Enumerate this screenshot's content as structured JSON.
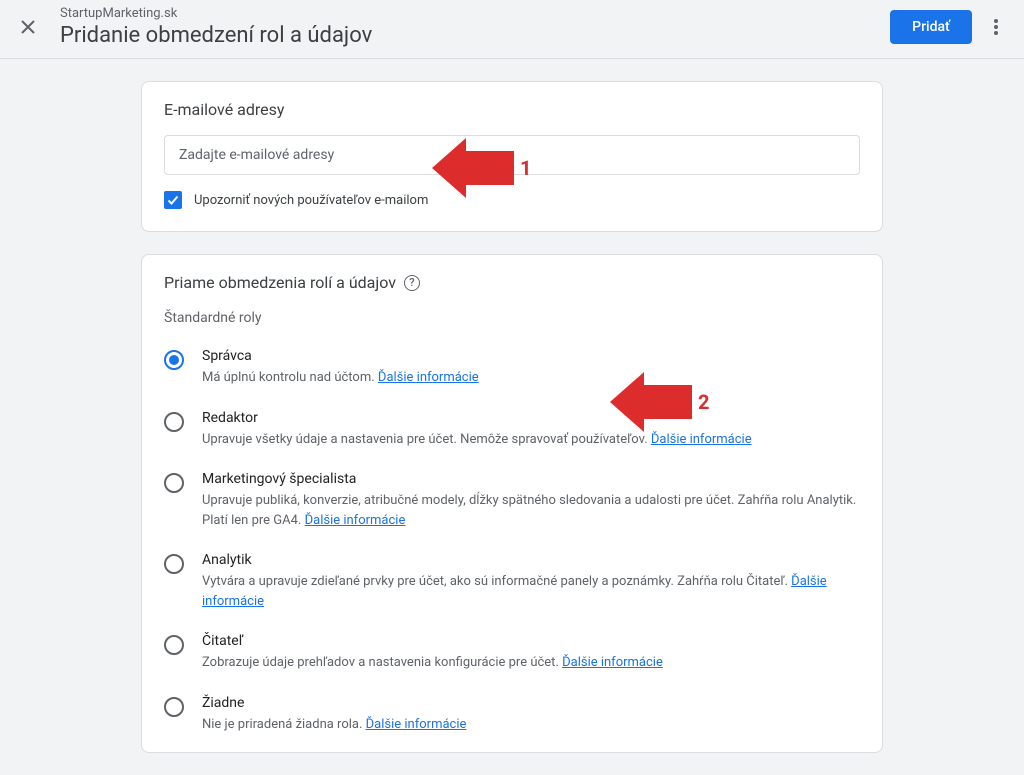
{
  "header": {
    "account": "StartupMarketing.sk",
    "page_title": "Pridanie obmedzení rol a údajov",
    "add_button": "Pridať"
  },
  "email_card": {
    "title": "E-mailové adresy",
    "placeholder": "Zadajte e-mailové adresy",
    "notify_label": "Upozorniť nových používateľov e-mailom"
  },
  "roles_card": {
    "section_title": "Priame obmedzenia rolí a údajov",
    "subsection": "Štandardné roly",
    "learn_more": "Ďalšie informácie",
    "roles": [
      {
        "name": "Správca",
        "desc": "Má úplnú kontrolu nad účtom.",
        "selected": true
      },
      {
        "name": "Redaktor",
        "desc": "Upravuje všetky údaje a nastavenia pre účet. Nemôže spravovať používateľov.",
        "selected": false
      },
      {
        "name": "Marketingový špecialista",
        "desc": "Upravuje publiká, konverzie, atribučné modely, dĺžky spätného sledovania a udalosti pre účet. Zahŕňa rolu Analytik. Platí len pre GA4.",
        "selected": false
      },
      {
        "name": "Analytik",
        "desc": "Vytvára a upravuje zdieľané prvky pre účet, ako sú informačné panely a poznámky. Zahŕňa rolu Čitateľ.",
        "selected": false
      },
      {
        "name": "Čitateľ",
        "desc": "Zobrazuje údaje prehľadov a nastavenia konfigurácie pre účet.",
        "selected": false
      },
      {
        "name": "Žiadne",
        "desc": "Nie je priradená žiadna rola.",
        "selected": false
      }
    ]
  },
  "annotations": {
    "arrow1": "1",
    "arrow2": "2"
  }
}
